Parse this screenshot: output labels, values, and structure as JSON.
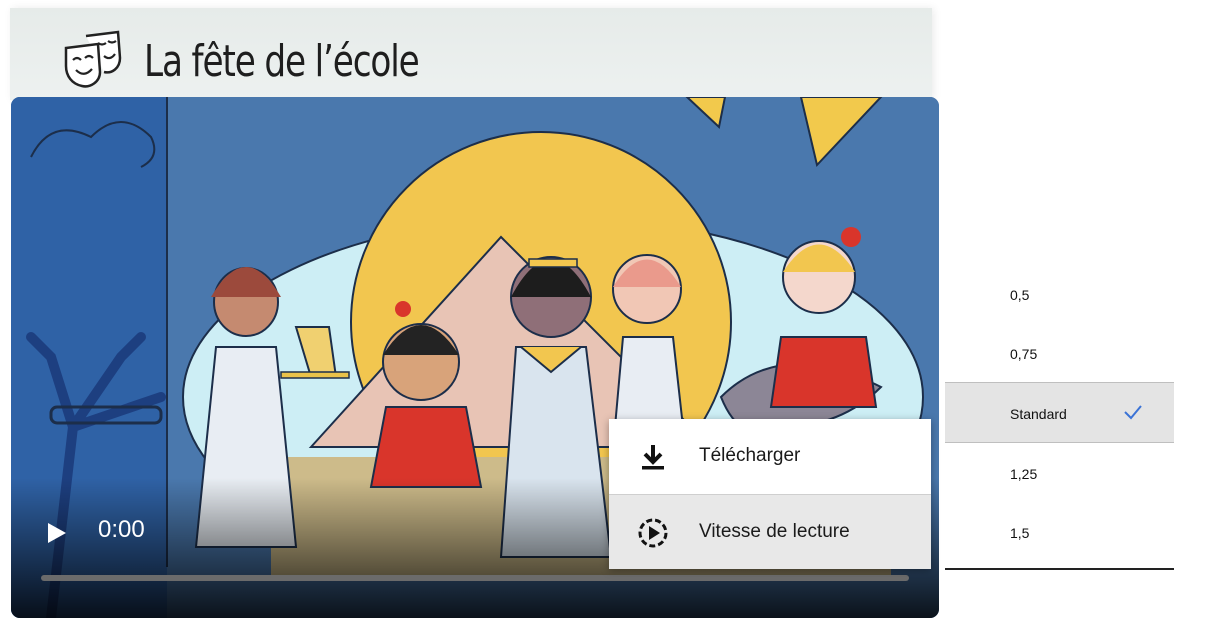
{
  "header": {
    "title": "La fête de l’école",
    "icon": "theater-masks-icon"
  },
  "player": {
    "time": "0:00",
    "progress": 0,
    "play_icon": "play-icon"
  },
  "menu": {
    "items": [
      {
        "label": "Télécharger",
        "icon": "download-icon"
      },
      {
        "label": "Vitesse de lecture",
        "icon": "playback-speed-icon"
      }
    ]
  },
  "speed": {
    "options": [
      "0,5",
      "0,75",
      "Standard",
      "1,25",
      "1,5"
    ],
    "selected": "Standard",
    "check_color": "#3b73d6"
  }
}
